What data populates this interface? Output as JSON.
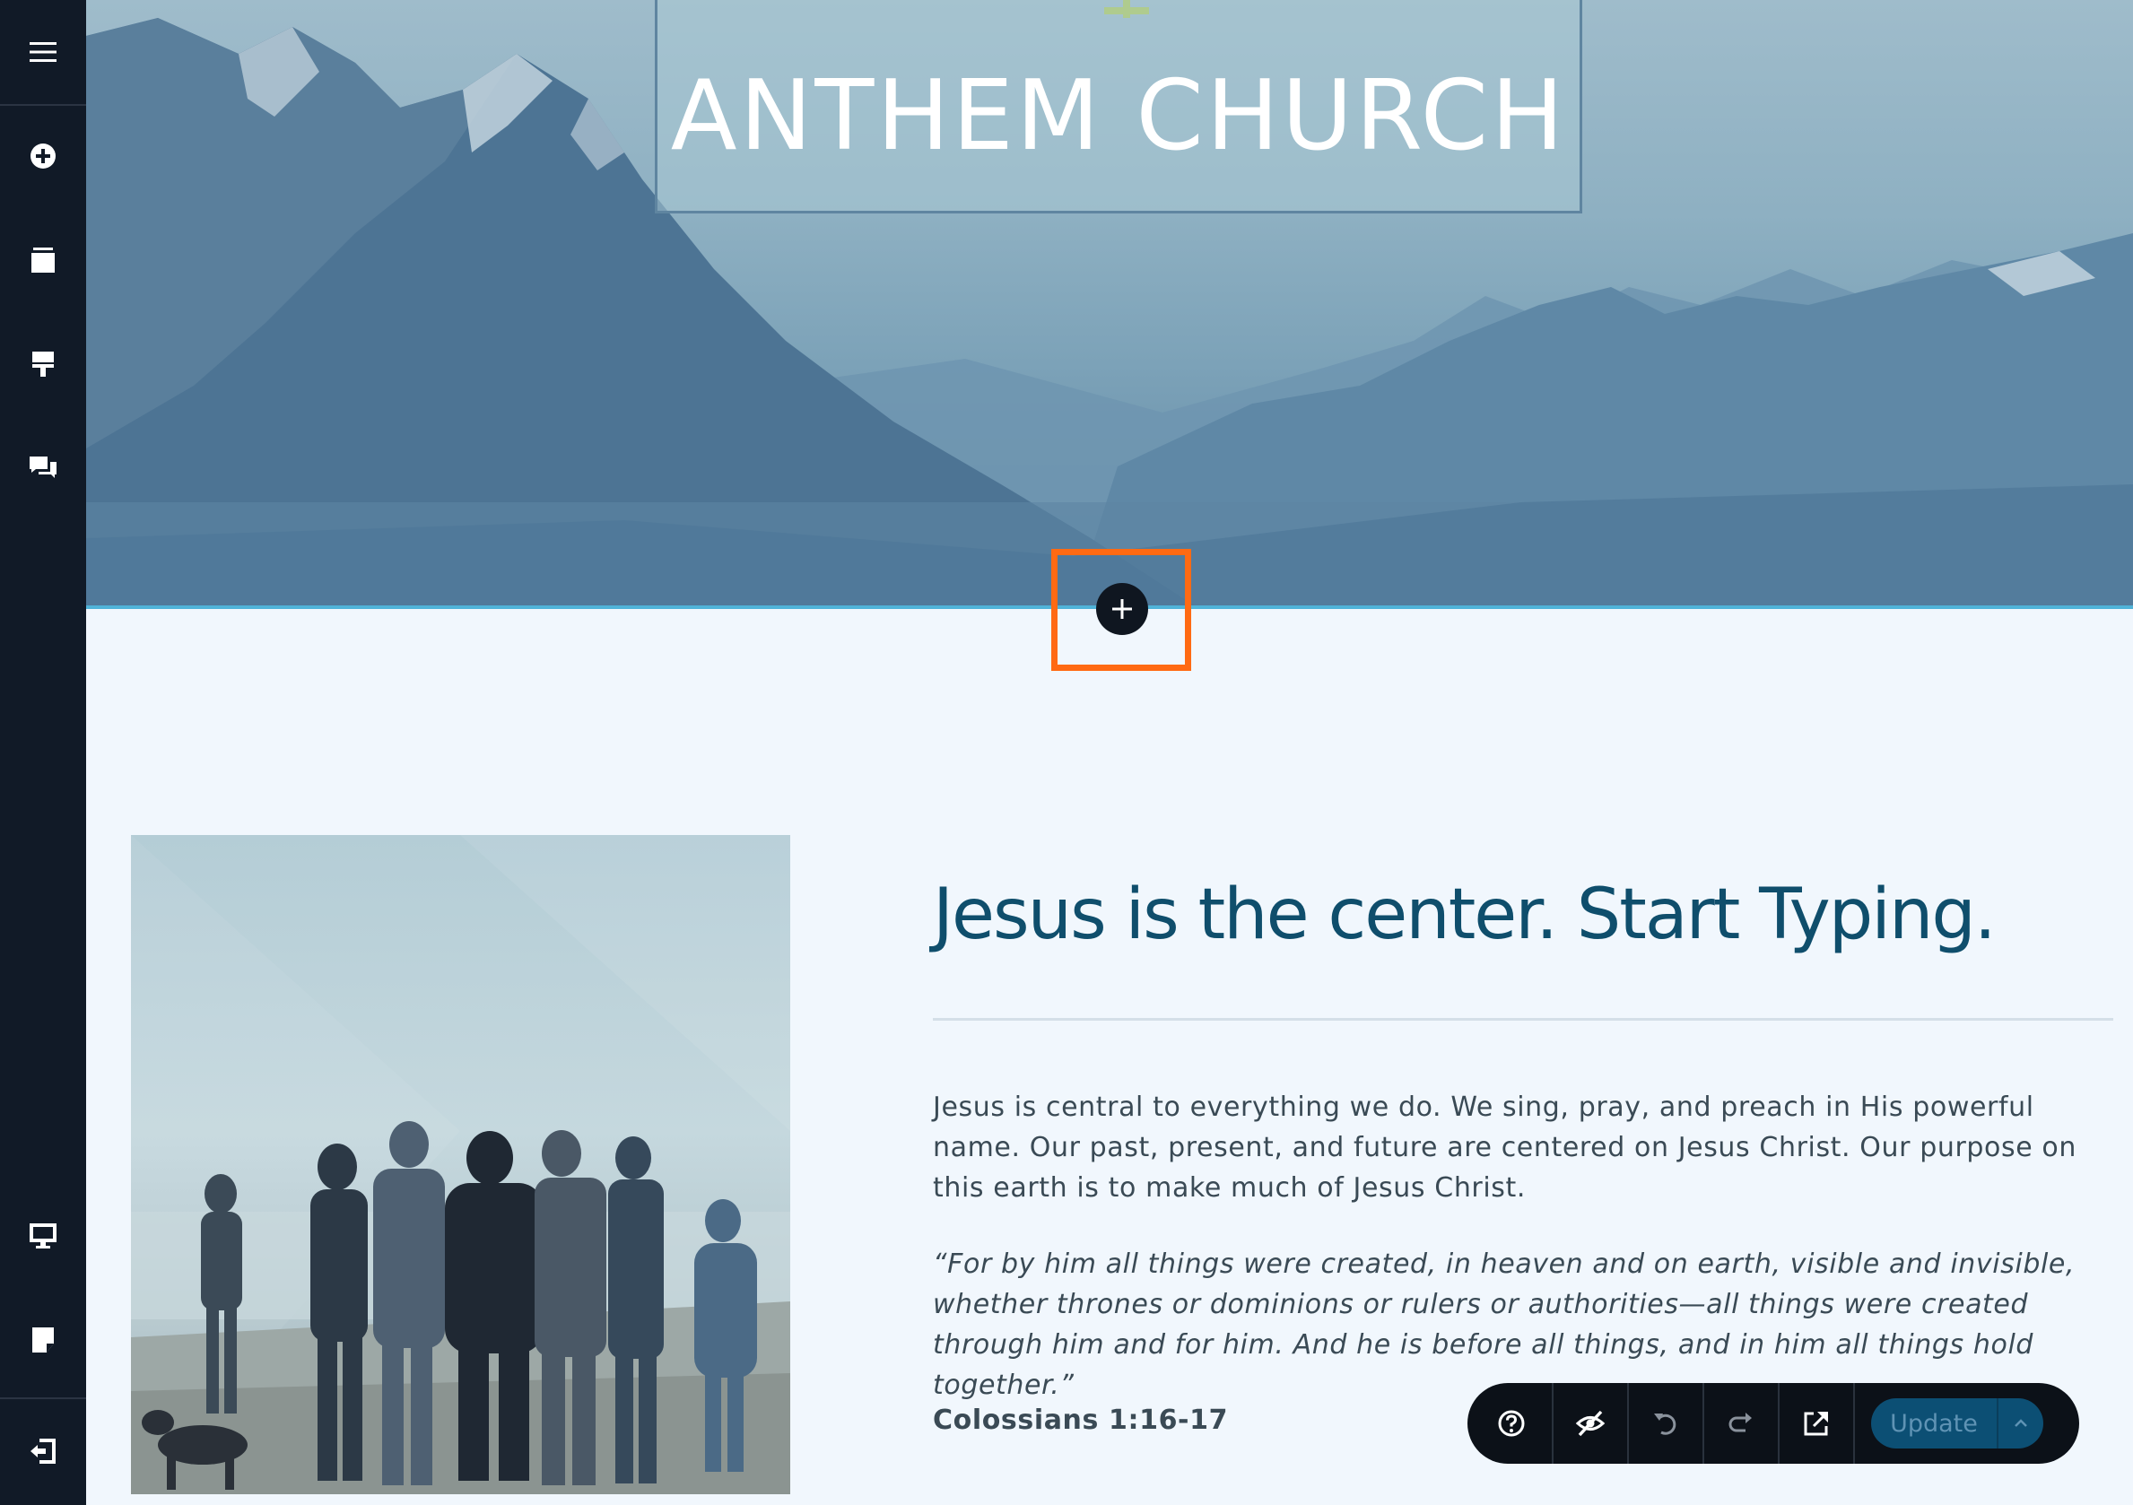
{
  "hero": {
    "title": "ANTHEM CHURCH"
  },
  "content": {
    "heading": "Jesus is the center. Start Typing.",
    "body": "Jesus is central to everything we do. We sing, pray, and preach in His powerful name. Our past, present, and future are centered on Jesus Christ. Our purpose on this earth is to make much of Jesus Christ.",
    "quote": "“For by him all things were created, in heaven and on earth, visible and invisible, whether thrones or dominions or rulers or authorities—all things were created through him and for him. And he is before all things, and in him all things hold together.”",
    "reference": "Colossians 1:16-17"
  },
  "toolbar": {
    "update_label": "Update"
  },
  "sidebar": {
    "top_icons": [
      "menu-icon",
      "add-circle-icon",
      "pages-icon",
      "theme-icon",
      "comments-icon"
    ],
    "bottom_icons": [
      "desktop-icon",
      "note-icon",
      "exit-icon"
    ]
  },
  "colors": {
    "sidebar_bg": "#111a27",
    "heading": "#0f4e6c",
    "highlight": "#ff6a13",
    "update_button": "#0c4f74",
    "accent_line": "#4fb3d8"
  }
}
